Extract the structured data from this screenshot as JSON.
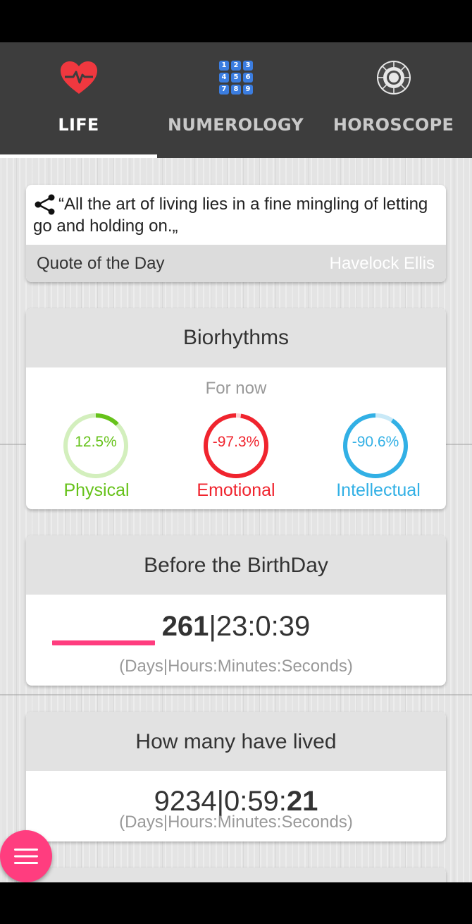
{
  "tabs": [
    {
      "label": "LIFE",
      "icon": "heart-pulse-icon",
      "active": true
    },
    {
      "label": "NUMEROLOGY",
      "icon": "number-grid-icon",
      "active": false
    },
    {
      "label": "HOROSCOPE",
      "icon": "zodiac-wheel-icon",
      "active": false
    }
  ],
  "numerology_grid": [
    "1",
    "2",
    "3",
    "4",
    "5",
    "6",
    "7",
    "8",
    "9"
  ],
  "quote": {
    "text": "“All the art of living lies in a fine mingling of letting go and holding on.„",
    "caption": "Quote of the Day",
    "author": "Havelock Ellis"
  },
  "biorhythms": {
    "title": "Biorhythms",
    "subtitle": "For now",
    "items": [
      {
        "label": "Physical",
        "value_text": "12.5%",
        "value": 12.5,
        "color": "#66c21a",
        "track": "#d3efbd"
      },
      {
        "label": "Emotional",
        "value_text": "-97.3%",
        "value": -97.3,
        "color": "#f0242e",
        "track": "#fbd0d2"
      },
      {
        "label": "Intellectual",
        "value_text": "-90.6%",
        "value": -90.6,
        "color": "#32b0e5",
        "track": "#c9e9f7"
      }
    ]
  },
  "birthday": {
    "title": "Before the BirthDay",
    "days": "261",
    "time": "|23:0:39",
    "units": "(Days|Hours:Minutes:Seconds)",
    "progress": 0.28
  },
  "lived": {
    "title": "How many have lived",
    "time_prefix": "9234|0:59:",
    "seconds": "21",
    "units": "(Days|Hours:Minutes:Seconds)"
  },
  "colors": {
    "accent": "#ff3d7f",
    "tab_bar": "#3d3d3d",
    "heart": "#f0383f",
    "numerology_blue": "#3b7de0"
  },
  "fab": {
    "icon": "menu-icon"
  }
}
